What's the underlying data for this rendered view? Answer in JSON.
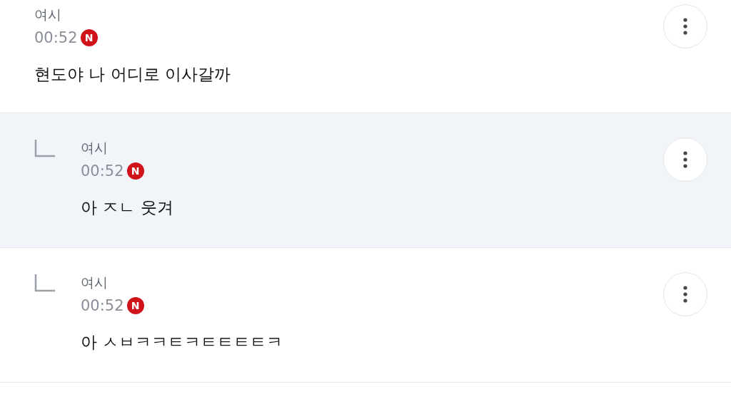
{
  "comments": [
    {
      "author": "여시",
      "time": "00:52",
      "badge": "N",
      "text": "현도야 나 어디로 이사갈까",
      "kind": "comment",
      "selected": false
    },
    {
      "author": "여시",
      "time": "00:52",
      "badge": "N",
      "text": "아 ㅈㄴ 웃겨",
      "kind": "reply",
      "selected": true
    },
    {
      "author": "여시",
      "time": "00:52",
      "badge": "N",
      "text": "아 ㅅㅂㅋㅋㅌㅋㅌㅌㅌㅌㅋ",
      "kind": "reply",
      "selected": false
    }
  ]
}
